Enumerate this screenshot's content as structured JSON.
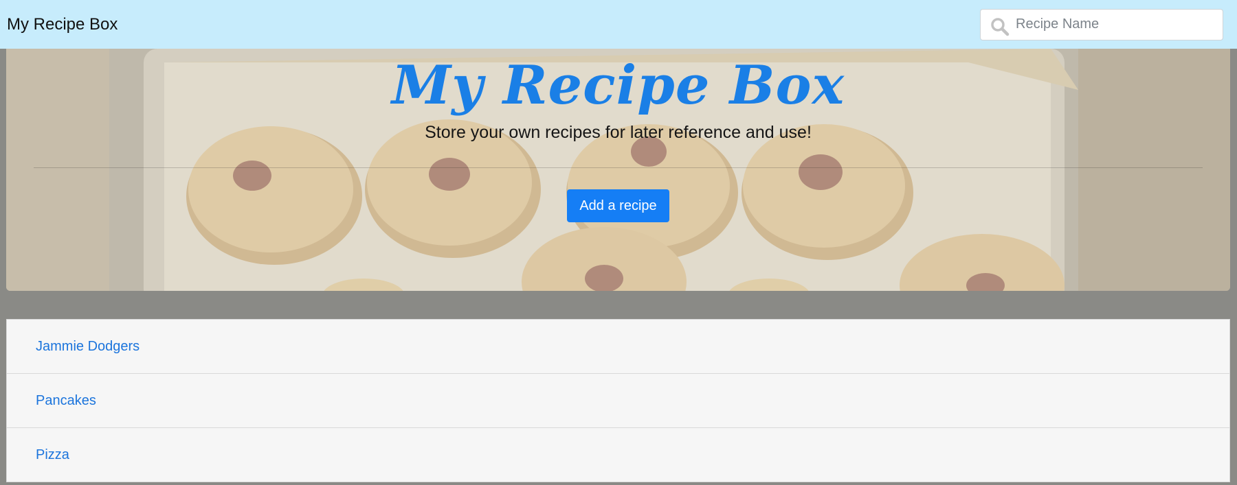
{
  "navbar": {
    "brand": "My Recipe Box",
    "search": {
      "placeholder": "Recipe Name",
      "value": "",
      "icon": "search-icon"
    }
  },
  "hero": {
    "title": "My Recipe Box",
    "subtitle": "Store your own recipes for later reference and use!",
    "add_button_label": "Add a recipe"
  },
  "recipes": [
    {
      "name": "Jammie Dodgers"
    },
    {
      "name": "Pancakes"
    },
    {
      "name": "Pizza"
    }
  ],
  "colors": {
    "navbar_bg": "#c7ecfc",
    "accent_blue": "#157ef5",
    "link_blue": "#1b74dc",
    "page_bg": "#8a8a86"
  }
}
